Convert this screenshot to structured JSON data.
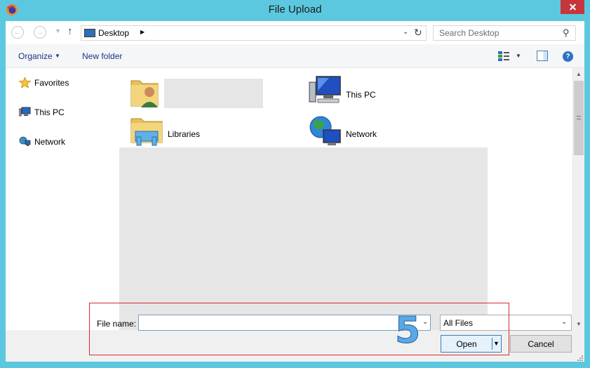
{
  "window": {
    "title": "File Upload",
    "app_icon": "firefox-icon",
    "close_icon": "close-icon"
  },
  "navbar": {
    "back_icon": "back-arrow-icon",
    "forward_icon": "forward-arrow-icon",
    "recent_icon": "chevron-down-icon",
    "up_icon": "up-arrow-icon",
    "address": {
      "icon": "desktop-icon",
      "path": "Desktop"
    },
    "refresh_icon": "refresh-icon",
    "search": {
      "placeholder": "Search Desktop",
      "icon": "search-icon"
    }
  },
  "toolbar": {
    "organize_label": "Organize",
    "new_folder_label": "New folder",
    "view_icon": "view-options-icon",
    "preview_pane_icon": "preview-pane-icon",
    "help_icon": "help-icon"
  },
  "sidebar": {
    "items": [
      {
        "label": "Favorites",
        "icon": "star-icon"
      },
      {
        "label": "This PC",
        "icon": "computer-icon"
      },
      {
        "label": "Network",
        "icon": "network-icon"
      }
    ]
  },
  "content": {
    "items": [
      {
        "label": "",
        "icon": "user-folder-icon"
      },
      {
        "label": "This PC",
        "icon": "computer-icon"
      },
      {
        "label": "Libraries",
        "icon": "libraries-icon"
      },
      {
        "label": "Network",
        "icon": "network-icon"
      }
    ]
  },
  "footer": {
    "file_name_label": "File name:",
    "file_name_value": "",
    "file_type_value": "All Files",
    "open_label": "Open",
    "cancel_label": "Cancel"
  },
  "annotation": {
    "step_number": "5"
  },
  "colors": {
    "frame": "#5bc8e0",
    "close_button": "#c7363d",
    "link_text": "#1e3287",
    "annotation_box": "#d62c2c",
    "annotation_number": "#5aa8e6"
  }
}
